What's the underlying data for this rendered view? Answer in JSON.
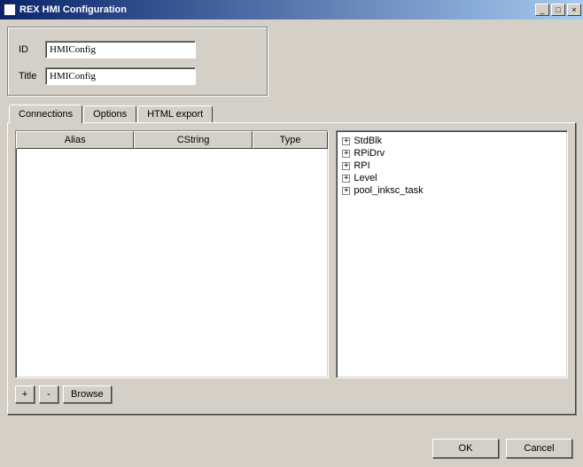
{
  "window": {
    "title": "REX HMI Configuration",
    "min_label": "_",
    "max_label": "□",
    "close_label": "×"
  },
  "form": {
    "id_label": "ID",
    "id_value": "HMIConfig",
    "title_label": "Title",
    "title_value": "HMIConfig"
  },
  "tabs": {
    "connections": "Connections",
    "options": "Options",
    "html_export": "HTML export"
  },
  "table": {
    "headers": {
      "alias": "Alias",
      "cstring": "CString",
      "type": "Type"
    }
  },
  "tree": {
    "items": [
      "StdBlk",
      "RPiDrv",
      "RPI",
      "Level",
      "pool_inksc_task"
    ]
  },
  "toolbar": {
    "add": "+",
    "remove": "-",
    "browse": "Browse"
  },
  "dialog": {
    "ok": "OK",
    "cancel": "Cancel"
  }
}
